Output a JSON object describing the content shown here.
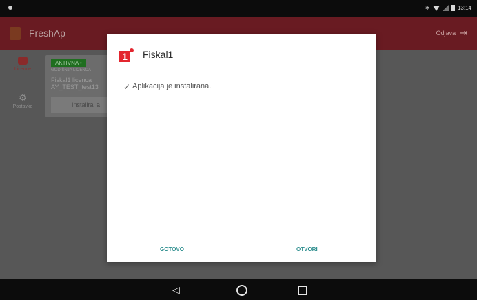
{
  "statusbar": {
    "time": "13:14"
  },
  "appbar": {
    "title": "FreshAp",
    "logout_label": "Odjava"
  },
  "sidebar": {
    "items": [
      {
        "label": "Licence",
        "icon": "licence-icon"
      },
      {
        "label": "Postavke",
        "icon": "gear-icon"
      }
    ]
  },
  "card": {
    "status_badge": "AKTIVNA •",
    "licence_type": "GODIŠNJA LICENCA",
    "line1": "Fiskal1 licenca",
    "line2": "AY_TEST_test13",
    "install_button": "Instaliraj a"
  },
  "dialog": {
    "title": "Fiskal1",
    "message": "Aplikacija je instalirana.",
    "done_button": "GOTOVO",
    "open_button": "OTVORI",
    "accent_color": "#2f8f8f",
    "icon_color": "#e3262f"
  }
}
